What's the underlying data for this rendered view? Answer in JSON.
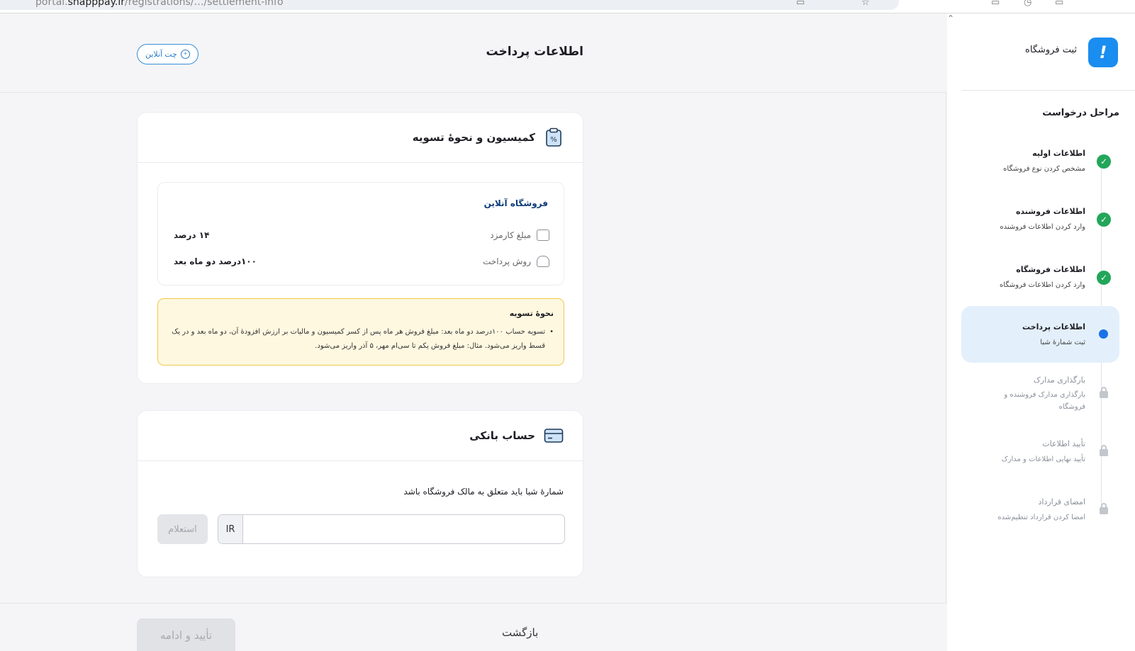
{
  "browser": {
    "url_prefix": "portal.",
    "url_domain": "snapppay.ir",
    "url_rest": "/registrations/…/settlement-info"
  },
  "header": {
    "title": "اطلاعات پرداخت",
    "chat_label": "چت آنلاین"
  },
  "commission": {
    "title": "کمیسیون و نحوهٔ تسویه",
    "store_type": "فروشگاه آنلاین",
    "fee_label": "مبلغ کارمزد",
    "fee_value": "۱۴ درصد",
    "method_label": "روش پرداخت",
    "method_value": "۱۰۰درصد دو ماه بعد",
    "note_title": "نحوهٔ تسویه",
    "note_body": "تسویه حساب ۱۰۰درصد دو ماه بعد: مبلغ فروش هر ماه پس از کسر کمیسیون و مالیات بر ارزش افزودهٔ آن، دو ماه بعد و در یک قسط واریز می‌شود. مثال: مبلغ فروش یکم تا سی‌ام مهر، ۵ آذر واریز می‌شود."
  },
  "bank": {
    "title": "حساب بانکی",
    "hint": "شمارهٔ شبا باید متعلق به مالک فروشگاه باشد",
    "iban_prefix": "IR",
    "iban_value": "",
    "inquiry_label": "استعلام"
  },
  "footer": {
    "confirm_label": "تأیید و ادامه",
    "back_label": "بازگشت"
  },
  "sidebar": {
    "title": "ثبت فروشگاه",
    "steps_title": "مراحل درخواست",
    "steps": [
      {
        "title": "اطلاعات اولیه",
        "desc": "مشخص کردن نوع فروشگاه",
        "state": "done"
      },
      {
        "title": "اطلاعات فروشنده",
        "desc": "وارد کردن اطلاعات فروشنده",
        "state": "done"
      },
      {
        "title": "اطلاعات فروشگاه",
        "desc": "وارد کردن اطلاعات فروشگاه",
        "state": "done"
      },
      {
        "title": "اطلاعات پرداخت",
        "desc": "ثبت شمارهٔ شبا",
        "state": "current"
      },
      {
        "title": "بارگذاری مدارک",
        "desc": "بارگذاری مدارک فروشنده و فروشگاه",
        "state": "locked"
      },
      {
        "title": "تأیید اطلاعات",
        "desc": "تأیید نهایی اطلاعات و مدارک",
        "state": "locked"
      },
      {
        "title": "امضای قرارداد",
        "desc": "امضا کردن قرارداد تنظیم‌شده",
        "state": "locked"
      }
    ]
  },
  "colors": {
    "accent": "#1a8df0",
    "done": "#22a65a",
    "note_bg": "#fff8e1",
    "note_border": "#f0c94a"
  }
}
